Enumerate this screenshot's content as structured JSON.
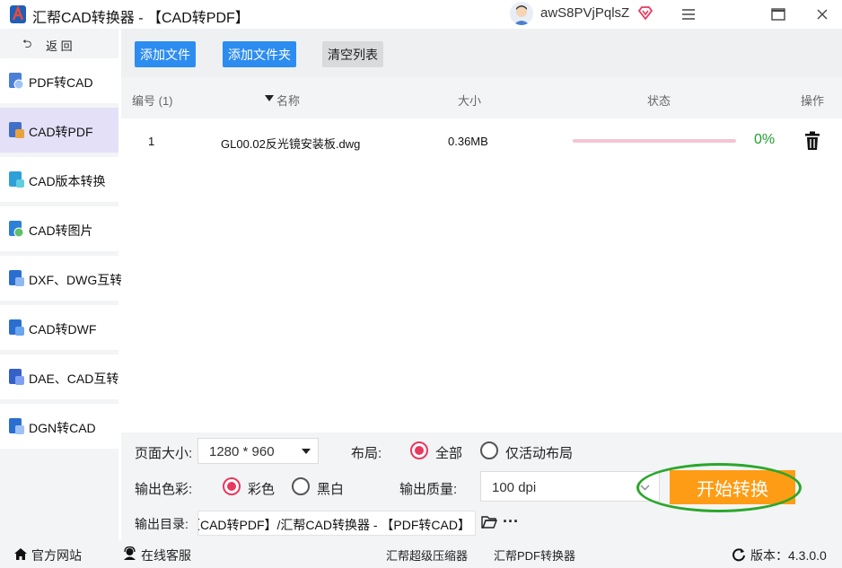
{
  "window": {
    "title": "汇帮CAD转换器 - 【CAD转PDF】",
    "username": "awS8PVjPqlsZ",
    "buttons": [
      "menu-icon",
      "minimize-icon",
      "close-icon"
    ]
  },
  "sidebar": {
    "back_label": "返 回",
    "items": [
      {
        "label": "PDF转CAD",
        "active": false
      },
      {
        "label": "CAD转PDF",
        "active": true
      },
      {
        "label": "CAD版本转换",
        "active": false
      },
      {
        "label": "CAD转图片",
        "active": false
      },
      {
        "label": "DXF、DWG互转",
        "active": false
      },
      {
        "label": "CAD转DWF",
        "active": false
      },
      {
        "label": "DAE、CAD互转",
        "active": false
      },
      {
        "label": "DGN转CAD",
        "active": false
      }
    ]
  },
  "toolbar": {
    "add_file": "添加文件",
    "add_folder": "添加文件夹",
    "clear_list": "清空列表"
  },
  "table": {
    "headers": {
      "index": "编号 (1)",
      "name": "名称",
      "size": "大小",
      "status": "状态",
      "action": "操作"
    },
    "rows": [
      {
        "index": "1",
        "name": "GL00.02反光镜安装板.dwg",
        "size": "0.36MB",
        "progress": 0,
        "percent": "0%"
      }
    ]
  },
  "options": {
    "page_size_label": "页面大小:",
    "page_size_value": "1280 * 960",
    "layout_label": "布局:",
    "layout_all": "全部",
    "layout_active": "仅活动布局",
    "layout_selected": "all",
    "color_label": "输出色彩:",
    "color_color": "彩色",
    "color_bw": "黑白",
    "color_selected": "color",
    "quality_label": "输出质量:",
    "quality_value": "100 dpi",
    "output_dir_label": "输出目录:",
    "output_dir_value": "【CAD转PDF】/汇帮CAD转换器 - 【PDF转CAD】",
    "start_button": "开始转换",
    "more": "···"
  },
  "footer": {
    "website": "官方网站",
    "support": "在线客服",
    "compressor": "汇帮超级压缩器",
    "pdf_converter": "汇帮PDF转换器",
    "version": "版本：4.3.0.0"
  },
  "colors": {
    "accent_blue": "#2d8cf0",
    "active_nav": "#e3e0f7",
    "start_orange": "#ff9c15",
    "radio_red": "#e8385e",
    "progress_green": "#1f9e2f"
  }
}
